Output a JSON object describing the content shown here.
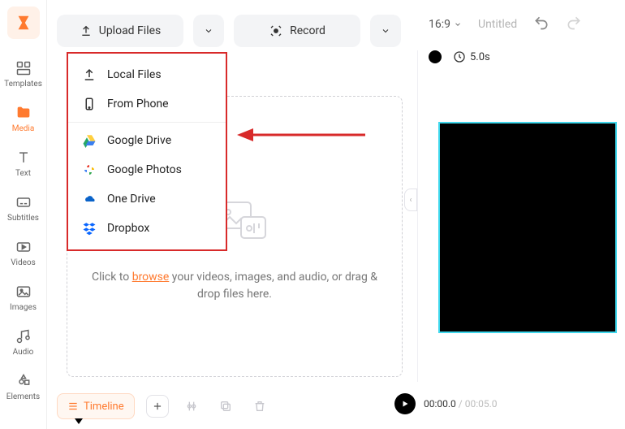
{
  "sidebar": {
    "items": [
      {
        "label": "Templates"
      },
      {
        "label": "Media"
      },
      {
        "label": "Text"
      },
      {
        "label": "Subtitles"
      },
      {
        "label": "Videos"
      },
      {
        "label": "Images"
      },
      {
        "label": "Audio"
      },
      {
        "label": "Elements"
      }
    ]
  },
  "toolbar": {
    "upload_label": "Upload Files",
    "record_label": "Record"
  },
  "header": {
    "ratio": "16:9",
    "title": "Untitled",
    "duration": "5.0s"
  },
  "dropdown": {
    "items": [
      {
        "label": "Local Files"
      },
      {
        "label": "From Phone"
      },
      {
        "label": "Google Drive"
      },
      {
        "label": "Google Photos"
      },
      {
        "label": "One Drive"
      },
      {
        "label": "Dropbox"
      }
    ]
  },
  "dropzone": {
    "pre": "Click to ",
    "link": "browse",
    "post": " your videos, images, and audio, or drag & drop files here."
  },
  "bottom": {
    "timeline_label": "Timeline"
  },
  "playback": {
    "current": "00:00.0",
    "total": "00:05.0"
  }
}
